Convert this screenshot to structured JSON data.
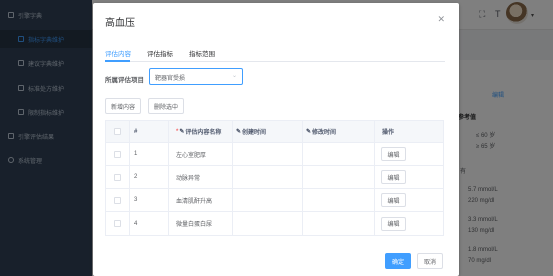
{
  "sidebar": {
    "items": [
      {
        "label": "引擎字典"
      },
      {
        "label": "指标字典维护"
      },
      {
        "label": "建议字典维护"
      },
      {
        "label": "标准处方维护"
      },
      {
        "label": "限制指标维护"
      },
      {
        "label": "引擎评估结果"
      },
      {
        "label": "系统管理"
      }
    ]
  },
  "background": {
    "right_panel_title": "参考值",
    "right_panel_edit": "编辑",
    "ages": [
      "≤ 60 岁",
      "≥ 65 岁"
    ],
    "has_label": "有",
    "values": [
      "5.7 mmol/L",
      "220 mg/dl",
      "3.3 mmol/L",
      "130 mg/dl",
      "1.8 mmol/L",
      "70 mg/dl"
    ]
  },
  "dialog": {
    "title": "高血压",
    "tabs": [
      "评估内容",
      "评估指标",
      "指标范围"
    ],
    "form_label": "所属评估项目",
    "select_value": "靶器官受损",
    "add_button": "新增内容",
    "delete_button": "删除选中",
    "table": {
      "headers": [
        "#",
        "评估内容名称",
        "创建时间",
        "修改时间",
        "操作"
      ],
      "rows": [
        {
          "index": "1",
          "name": "左心室肥厚",
          "created": "",
          "modified": "",
          "action": "编辑"
        },
        {
          "index": "2",
          "name": "动脉异常",
          "created": "",
          "modified": "",
          "action": "编辑"
        },
        {
          "index": "3",
          "name": "血清肌酐升高",
          "created": "",
          "modified": "",
          "action": "编辑"
        },
        {
          "index": "4",
          "name": "微量白蛋白尿",
          "created": "",
          "modified": "",
          "action": "编辑"
        }
      ]
    },
    "ok_button": "确定",
    "cancel_button": "取消"
  }
}
